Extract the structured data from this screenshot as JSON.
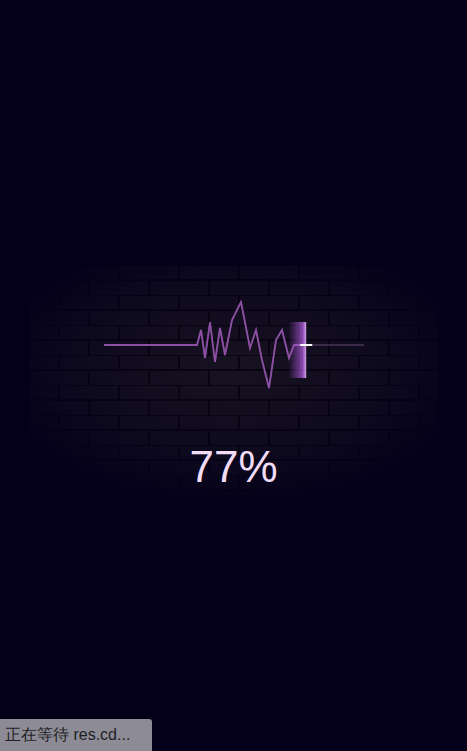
{
  "loader": {
    "progress_text": "77%",
    "level": 0.77
  },
  "status_bar": {
    "text": "正在等待 res.cd..."
  }
}
